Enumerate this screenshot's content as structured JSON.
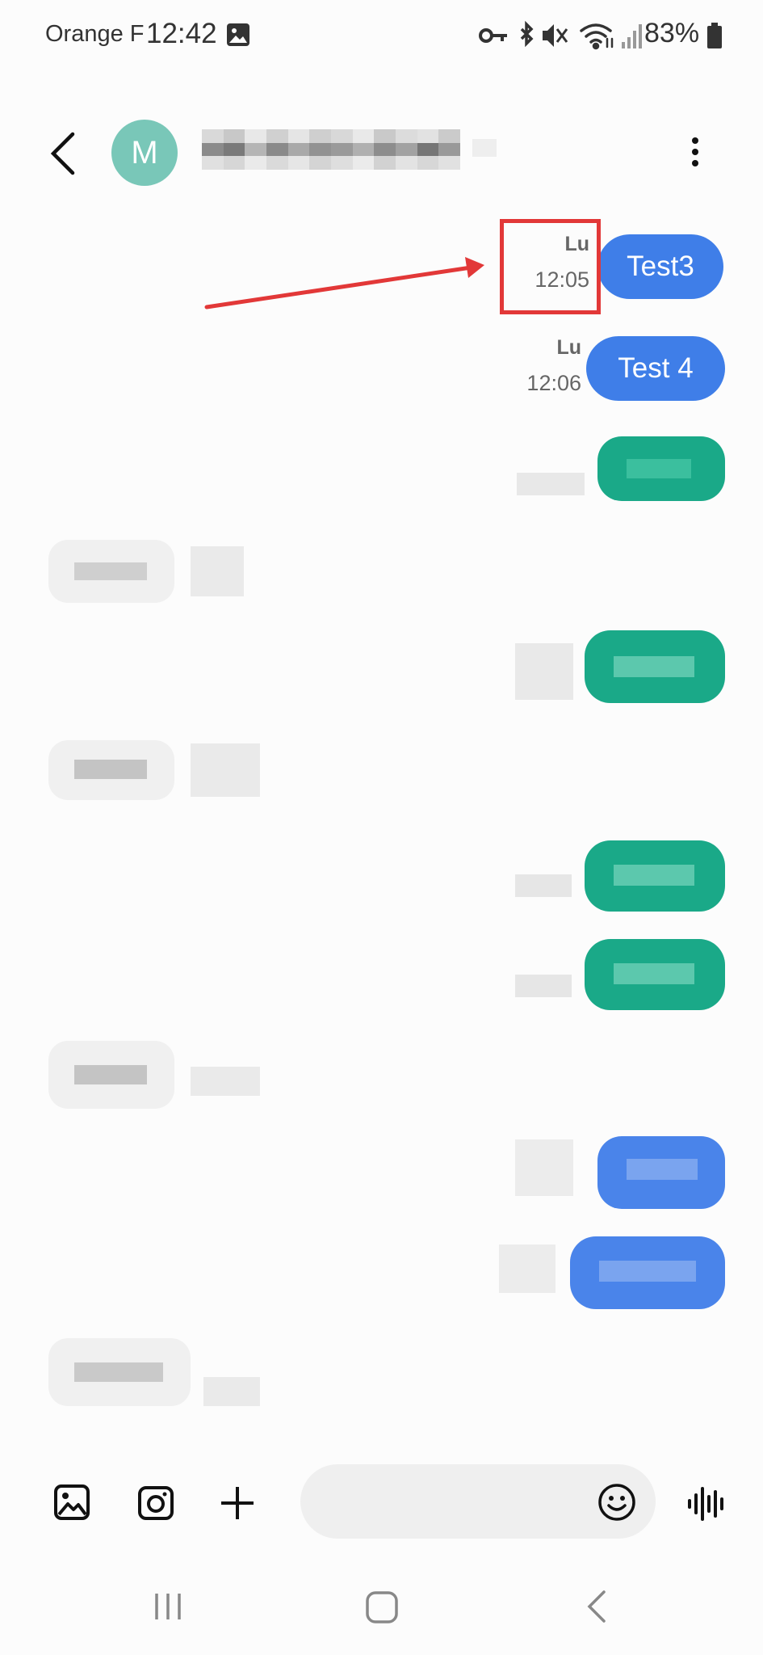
{
  "status_bar": {
    "carrier": "Orange F",
    "time": "12:42",
    "battery": "83%",
    "icons": [
      "gallery-icon",
      "key-icon",
      "bluetooth-icon",
      "mute-icon",
      "wifi-icon",
      "signal-icon",
      "battery-icon"
    ]
  },
  "header": {
    "avatar_letter": "M",
    "avatar_color": "#79c7b8"
  },
  "messages": [
    {
      "text": "Test3",
      "day": "Lu",
      "time": "12:05",
      "direction": "outgoing",
      "highlighted": true
    },
    {
      "text": "Test 4",
      "day": "Lu",
      "time": "12:06",
      "direction": "outgoing",
      "highlighted": false
    }
  ],
  "colors": {
    "outgoing_bubble": "#3f7ee8",
    "highlight": "#e23838",
    "blurred_green": "#1aa988"
  },
  "composer": {
    "icons": [
      "gallery-icon",
      "camera-icon",
      "plus-icon",
      "emoji-icon",
      "voice-icon"
    ]
  },
  "navigation": {
    "icons": [
      "recents-icon",
      "home-icon",
      "back-icon"
    ]
  }
}
